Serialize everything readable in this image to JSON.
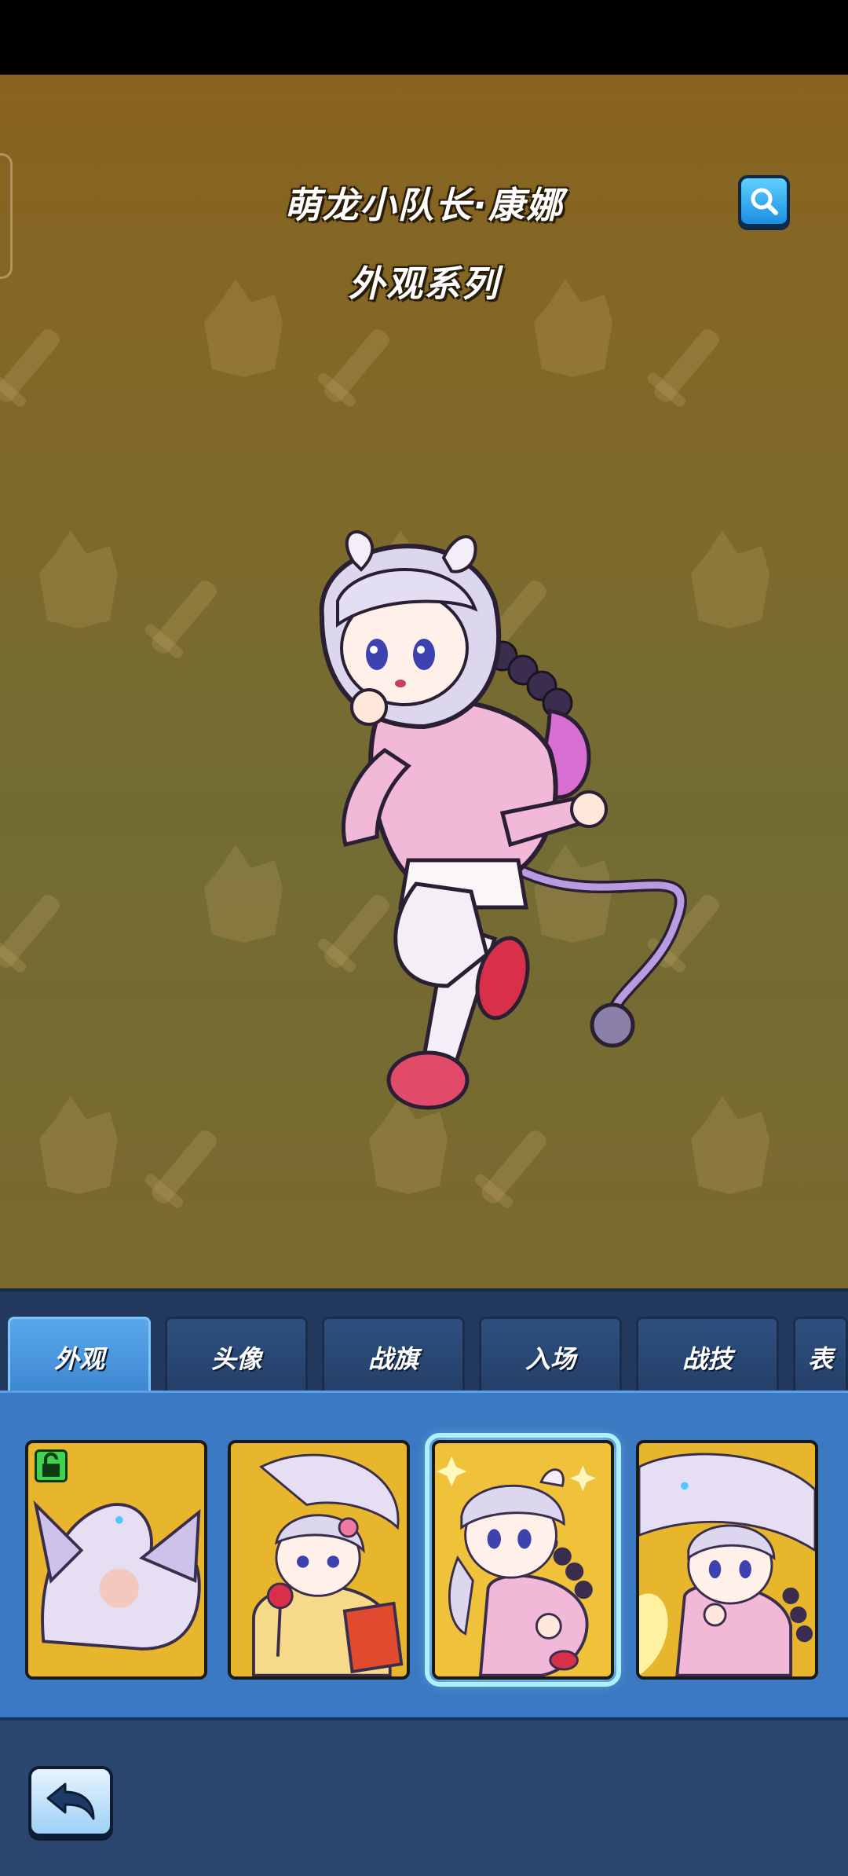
{
  "header": {
    "title": "萌龙小队长·康娜",
    "subtitle": "外观系列",
    "search_icon": "magnifier-icon"
  },
  "tabs": [
    {
      "label": "外观",
      "active": true
    },
    {
      "label": "头像",
      "active": false
    },
    {
      "label": "战旗",
      "active": false
    },
    {
      "label": "入场",
      "active": false
    },
    {
      "label": "战技",
      "active": false
    },
    {
      "label": "表",
      "active": false
    }
  ],
  "skins": [
    {
      "name": "dragon-form",
      "badge": "unlock-icon",
      "selected": false
    },
    {
      "name": "festival-kimono",
      "selected": false
    },
    {
      "name": "default-outfit",
      "selected": true
    },
    {
      "name": "dragon-companion",
      "selected": false
    }
  ],
  "footer": {
    "back_icon": "back-arrow-icon"
  },
  "colors": {
    "stage_bg": "#7e6a2a",
    "panel_bg": "#2b4770",
    "active_tab": "#4a96df",
    "card_bg": "#e8b62d"
  }
}
